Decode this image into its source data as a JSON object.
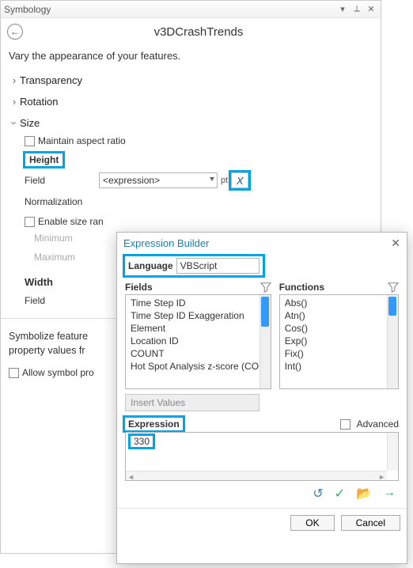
{
  "pane": {
    "title": "Symbology",
    "pin_icon": "pin-icon",
    "close_icon": "close-icon",
    "back_icon": "back-arrow-icon",
    "subtitle": "v3DCrashTrends",
    "vary_text": "Vary the appearance of your features."
  },
  "groups": {
    "transparency": "Transparency",
    "rotation": "Rotation",
    "size": "Size"
  },
  "size": {
    "maintain_aspect": "Maintain aspect ratio",
    "height_label": "Height",
    "field_label": "Field",
    "field_value": "<expression>",
    "unit": "pt",
    "expression_btn": "X",
    "normalization_label": "Normalization",
    "enable_size_range": "Enable size ran",
    "minimum": "Minimum",
    "maximum": "Maximum",
    "width_label": "Width",
    "width_field_label": "Field"
  },
  "bottom": {
    "symbolize_text": "Symbolize feature",
    "property_text": "property values fr",
    "allow_symbol": "Allow symbol pro"
  },
  "popup": {
    "title": "Expression Builder",
    "language_label": "Language",
    "language_value": "VBScript",
    "fields_label": "Fields",
    "functions_label": "Functions",
    "fields_list": [
      "Time Step ID",
      "Time Step ID Exaggeration",
      "Element",
      "Location ID",
      "COUNT",
      "Hot Spot Analysis z-score (COU"
    ],
    "functions_list": [
      "Abs()",
      "Atn()",
      "Cos()",
      "Exp()",
      "Fix()",
      "Int()"
    ],
    "insert_values": "Insert Values",
    "expression_label": "Expression",
    "advanced_label": "Advanced",
    "expression_value": "330",
    "ok": "OK",
    "cancel": "Cancel",
    "icons": {
      "undo": "↺",
      "check": "✓",
      "folder": "📂",
      "go": "→"
    }
  }
}
